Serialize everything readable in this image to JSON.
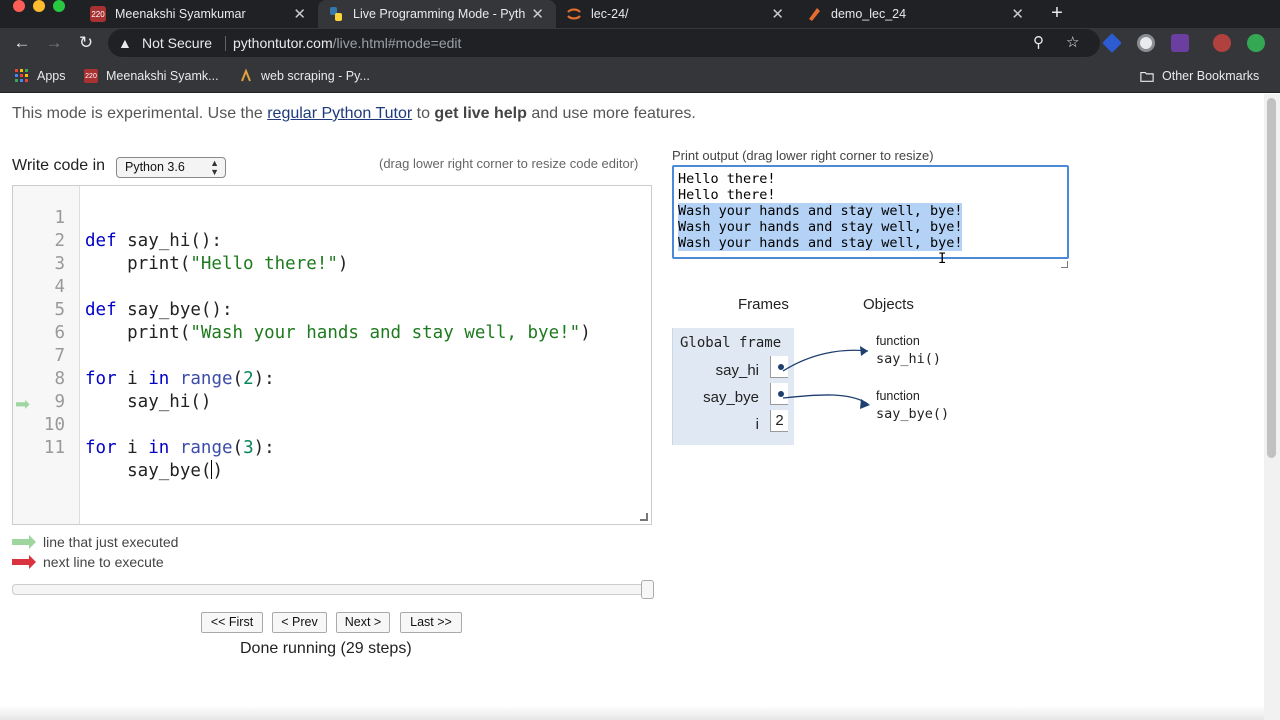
{
  "browser": {
    "tabs": [
      {
        "title": "Meenakshi Syamkumar",
        "favicon": "220",
        "favicon_color": "#a83232",
        "active": false
      },
      {
        "title": "Live Programming Mode - Pyth",
        "favicon": "python-icon",
        "favicon_color": "#3776ab",
        "active": true
      },
      {
        "title": "lec-24/",
        "favicon": "jupyter-icon",
        "favicon_color": "#e46e2e",
        "active": false
      },
      {
        "title": "demo_lec_24",
        "favicon": "notebook-icon",
        "favicon_color": "#e46e2e",
        "active": false
      }
    ],
    "close_glyph": "✕",
    "new_tab_glyph": "+",
    "security_label": "Not Secure",
    "url_host": "pythontutor.com",
    "url_path": "/live.html#mode=edit",
    "bookmarks": [
      {
        "label": "Apps",
        "icon": "apps-grid-icon"
      },
      {
        "label": "Meenakshi Syamk...",
        "icon": "220"
      },
      {
        "label": "web scraping - Py...",
        "icon": "python-icon"
      }
    ],
    "other_bookmarks_label": "Other Bookmarks"
  },
  "banner": {
    "prefix": "This mode is experimental. Use the ",
    "link": "regular Python Tutor",
    "middle": " to ",
    "bold": "get live help",
    "suffix": " and use more features."
  },
  "editor_header": {
    "write_code_label": "Write code in",
    "language": "Python 3.6",
    "drag_hint": "(drag lower right corner to resize code editor)"
  },
  "code_lines": [
    {
      "num": "1",
      "text": "def say_hi():"
    },
    {
      "num": "2",
      "text": "    print(\"Hello there!\")"
    },
    {
      "num": "3",
      "text": ""
    },
    {
      "num": "4",
      "text": "def say_bye():"
    },
    {
      "num": "5",
      "text": "    print(\"Wash your hands and stay well, bye!\")"
    },
    {
      "num": "6",
      "text": ""
    },
    {
      "num": "7",
      "text": "for i in range(2):"
    },
    {
      "num": "8",
      "text": "    say_hi()"
    },
    {
      "num": "9",
      "text": ""
    },
    {
      "num": "10",
      "text": "for i in range(3):"
    },
    {
      "num": "11",
      "text": "    say_bye()"
    }
  ],
  "current_line": "10",
  "legend": {
    "just_executed": "line that just executed",
    "next_line": "next line to execute",
    "just_executed_color": "#9fd69f",
    "next_line_color": "#d9333f"
  },
  "step_progress": 1.0,
  "nav": {
    "first": "<< First",
    "prev": "< Prev",
    "next": "Next >",
    "last": "Last >>"
  },
  "status": "Done running (29 steps)",
  "print_output": {
    "label": "Print output (drag lower right corner to resize)",
    "lines": [
      {
        "text": "Hello there!",
        "selected": false
      },
      {
        "text": "Hello there!",
        "selected": false
      },
      {
        "text": "Wash your hands and stay well, bye!",
        "selected": true
      },
      {
        "text": "Wash your hands and stay well, bye!",
        "selected": true
      },
      {
        "text": "Wash your hands and stay well, bye!",
        "selected": true
      }
    ]
  },
  "visualizer": {
    "frames_title": "Frames",
    "objects_title": "Objects",
    "global_frame_title": "Global frame",
    "variables": [
      {
        "name": "say_hi",
        "value": ""
      },
      {
        "name": "say_bye",
        "value": ""
      },
      {
        "name": "i",
        "value": "2"
      }
    ],
    "objects": [
      {
        "kind": "function",
        "name": "say_hi()"
      },
      {
        "kind": "function",
        "name": "say_bye()"
      }
    ]
  }
}
